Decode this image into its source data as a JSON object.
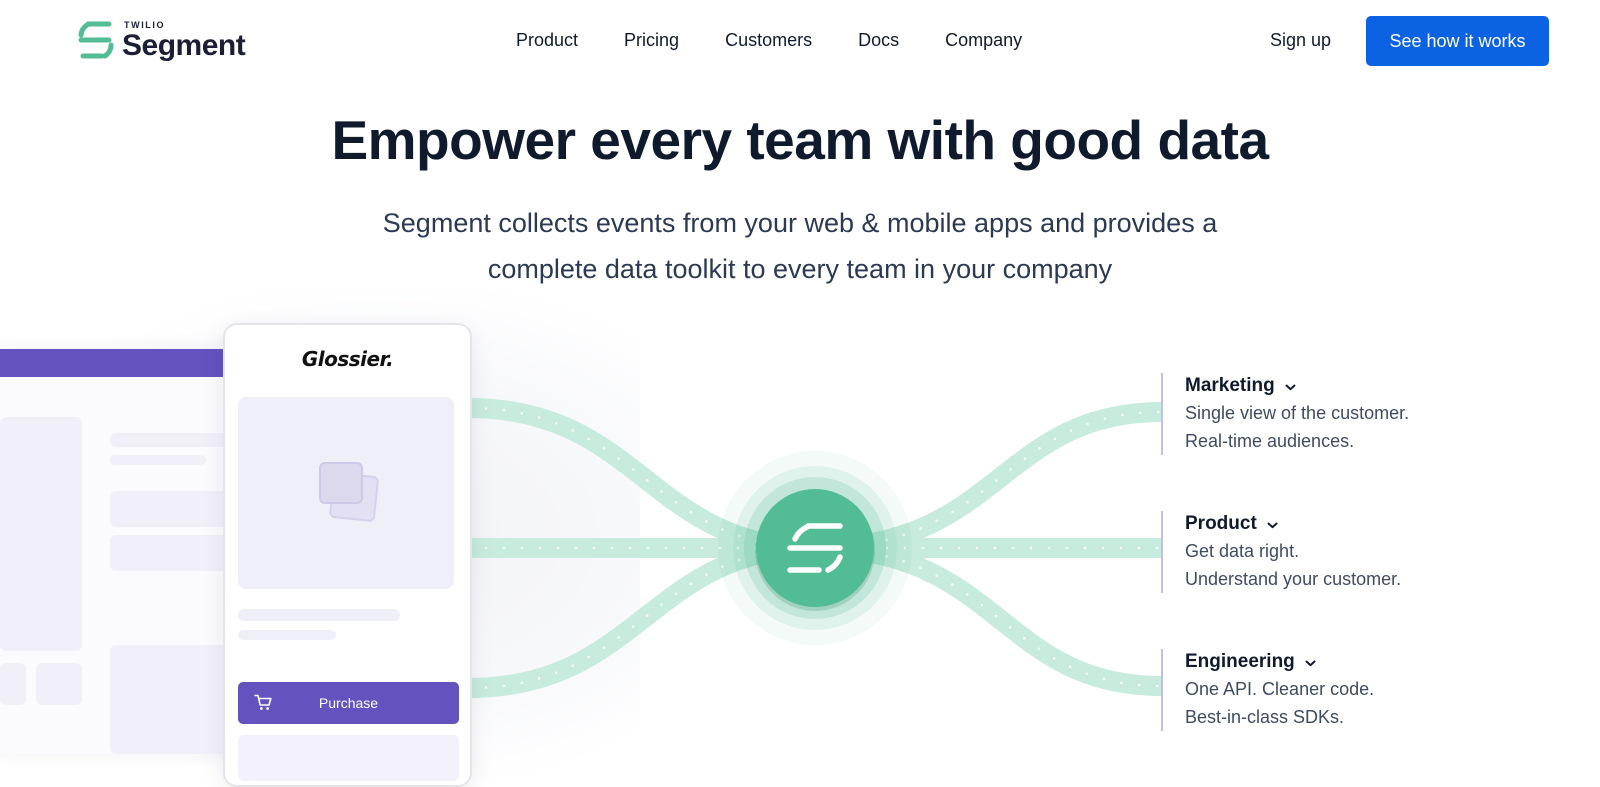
{
  "header": {
    "logo": {
      "small": "TWILIO",
      "word": "Segment"
    },
    "nav": [
      "Product",
      "Pricing",
      "Customers",
      "Docs",
      "Company"
    ],
    "signup": "Sign up",
    "cta": "See how it works"
  },
  "hero": {
    "title": "Empower every team with good data",
    "subtitle_line1": "Segment collects events from your web & mobile apps and provides a",
    "subtitle_line2": "complete data toolkit to every team in your company"
  },
  "illustration": {
    "phone_brand": "Glossier.",
    "purchase_label": "Purchase",
    "icons": [
      "image-placeholder-icon",
      "cart-icon",
      "segment-hub-icon",
      "chevron-down-icon"
    ]
  },
  "features": [
    {
      "title": "Marketing",
      "lines": [
        "Single view of the customer.",
        "Real-time audiences."
      ]
    },
    {
      "title": "Product",
      "lines": [
        "Get data right.",
        "Understand your customer."
      ]
    },
    {
      "title": "Engineering",
      "lines": [
        "One API. Cleaner code.",
        "Best-in-class SDKs."
      ]
    }
  ],
  "colors": {
    "brand_green": "#52bd94",
    "primary_blue": "#0b62e3",
    "purple": "#6453be",
    "ribbon": "#c7ebdc",
    "text_dark": "#0f1b2d"
  }
}
